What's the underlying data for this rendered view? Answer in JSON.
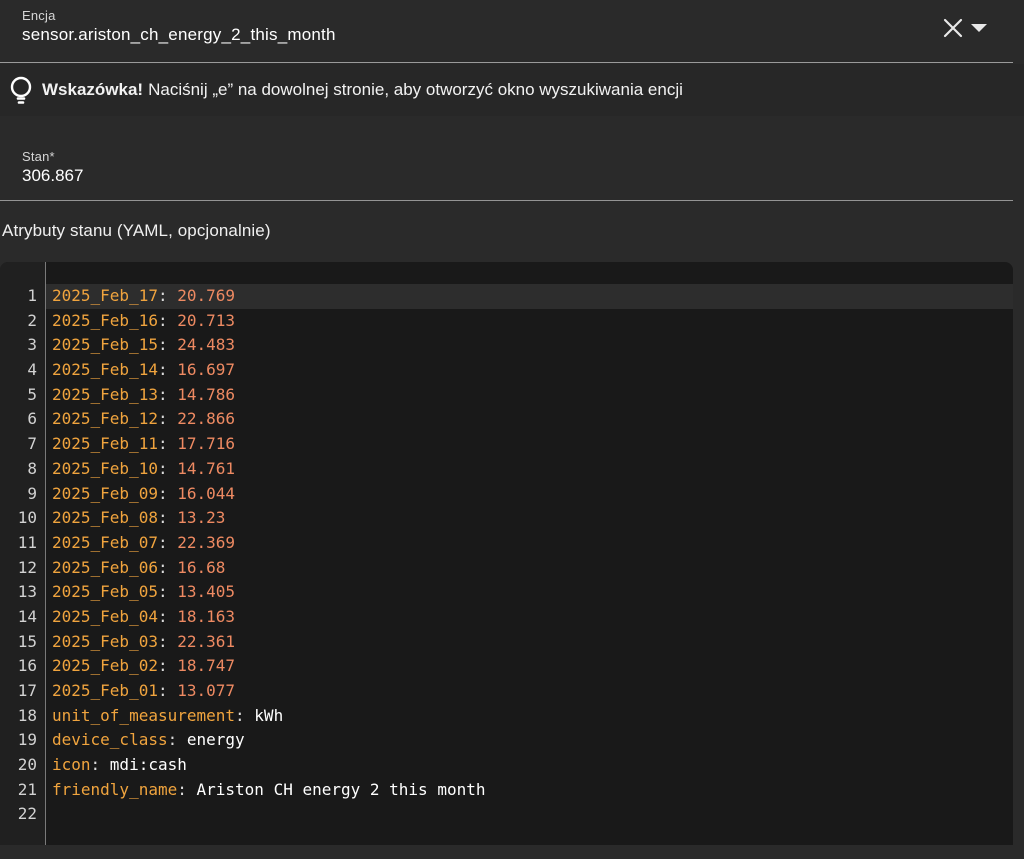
{
  "entity_field": {
    "label": "Encja",
    "value": "sensor.ariston_ch_energy_2_this_month"
  },
  "tip": {
    "title": "Wskazówka!",
    "text": "Naciśnij „e” na dowolnej stronie, aby otworzyć okno wyszukiwania encji"
  },
  "state_field": {
    "label": "Stan*",
    "value": "306.867"
  },
  "attributes": {
    "heading": "Atrybuty stanu (YAML, opcjonalnie)"
  },
  "editor": {
    "language": "YAML",
    "active_line": 1,
    "colors": {
      "key": "#f0a43e",
      "number": "#ee8a62",
      "string": "#ffffff",
      "punctuation": "#dcdcdc",
      "background": "#191919",
      "gutter_background": "#202020",
      "active_line_background": "#2d2d2d",
      "line_number": "#d2d2d2"
    },
    "lines": [
      {
        "key": "2025_Feb_17",
        "value": "20.769",
        "type": "number"
      },
      {
        "key": "2025_Feb_16",
        "value": "20.713",
        "type": "number"
      },
      {
        "key": "2025_Feb_15",
        "value": "24.483",
        "type": "number"
      },
      {
        "key": "2025_Feb_14",
        "value": "16.697",
        "type": "number"
      },
      {
        "key": "2025_Feb_13",
        "value": "14.786",
        "type": "number"
      },
      {
        "key": "2025_Feb_12",
        "value": "22.866",
        "type": "number"
      },
      {
        "key": "2025_Feb_11",
        "value": "17.716",
        "type": "number"
      },
      {
        "key": "2025_Feb_10",
        "value": "14.761",
        "type": "number"
      },
      {
        "key": "2025_Feb_09",
        "value": "16.044",
        "type": "number"
      },
      {
        "key": "2025_Feb_08",
        "value": "13.23",
        "type": "number"
      },
      {
        "key": "2025_Feb_07",
        "value": "22.369",
        "type": "number"
      },
      {
        "key": "2025_Feb_06",
        "value": "16.68",
        "type": "number"
      },
      {
        "key": "2025_Feb_05",
        "value": "13.405",
        "type": "number"
      },
      {
        "key": "2025_Feb_04",
        "value": "18.163",
        "type": "number"
      },
      {
        "key": "2025_Feb_03",
        "value": "22.361",
        "type": "number"
      },
      {
        "key": "2025_Feb_02",
        "value": "18.747",
        "type": "number"
      },
      {
        "key": "2025_Feb_01",
        "value": "13.077",
        "type": "number"
      },
      {
        "key": "unit_of_measurement",
        "value": "kWh",
        "type": "string"
      },
      {
        "key": "device_class",
        "value": "energy",
        "type": "string"
      },
      {
        "key": "icon",
        "value": "mdi:cash",
        "type": "string"
      },
      {
        "key": "friendly_name",
        "value": "Ariston CH energy 2 this month",
        "type": "string"
      },
      {
        "key": "",
        "value": "",
        "type": "empty"
      }
    ]
  }
}
